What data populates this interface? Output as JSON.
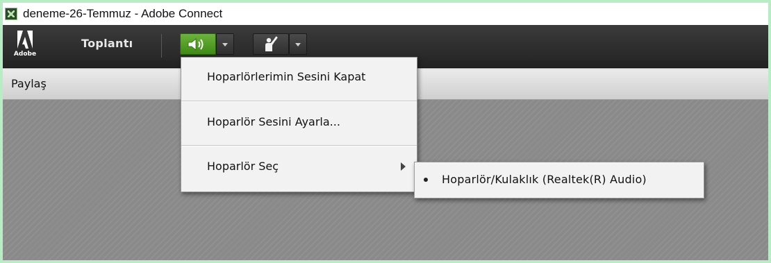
{
  "window": {
    "title": "deneme-26-Temmuz - Adobe Connect"
  },
  "menubar": {
    "logo_text": "Adobe",
    "meeting_menu": "Toplantı",
    "icons": {
      "speaker": "speaker-icon",
      "raise_hand": "raise-hand-icon"
    },
    "colors": {
      "speaker_active": "#5aa12a"
    }
  },
  "pod": {
    "title": "Paylaş"
  },
  "speaker_menu": {
    "items": [
      {
        "label": "Hoparlörlerimin Sesini Kapat"
      },
      {
        "label": "Hoparlör Sesini Ayarla..."
      },
      {
        "label": "Hoparlör Seç"
      }
    ],
    "submenu": {
      "items": [
        {
          "label": "Hoparlör/Kulaklık (Realtek(R) Audio)",
          "selected": true
        }
      ]
    }
  }
}
